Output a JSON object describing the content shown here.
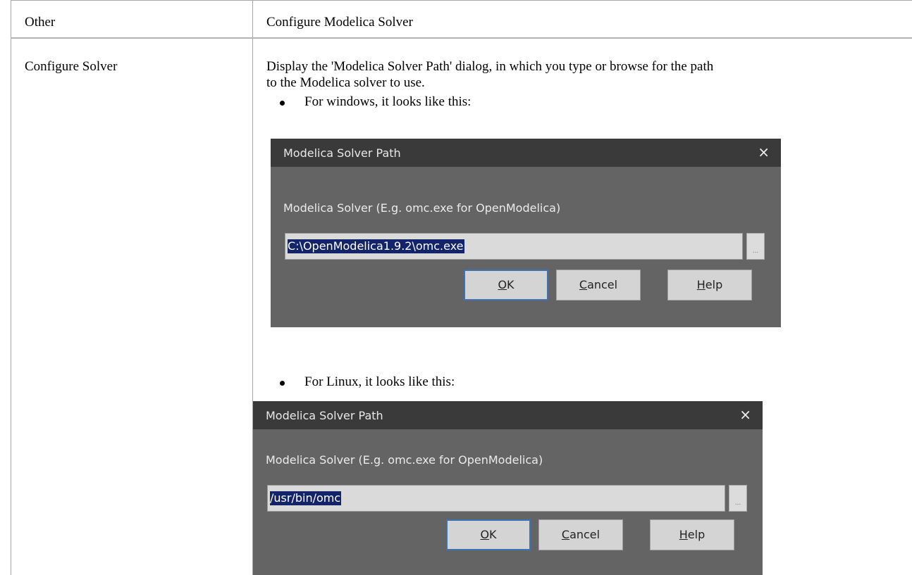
{
  "table": {
    "header": {
      "left": "Other",
      "right": "Configure Modelica Solver"
    },
    "row": {
      "left": "Configure Solver",
      "description_line1": "Display the 'Modelica Solver Path' dialog, in which you type or browse for the path",
      "description_line2": "to the Modelica solver to use.",
      "bullet_windows": "For windows, it looks like this:",
      "bullet_linux": "For Linux, it looks like this:"
    }
  },
  "dialog_windows": {
    "title": "Modelica Solver Path",
    "close_glyph": "×",
    "label": "Modelica Solver (E.g. omc.exe for OpenModelica)",
    "path_value": "C:\\OpenModelica1.9.2\\omc.exe",
    "browse_label": "...",
    "ok_key": "O",
    "ok_rest": "K",
    "cancel_key": "C",
    "cancel_rest": "ancel",
    "help_key": "H",
    "help_rest": "elp"
  },
  "dialog_linux": {
    "title": "Modelica Solver Path",
    "close_glyph": "×",
    "label": "Modelica Solver (E.g. omc.exe for OpenModelica)",
    "path_value": "/usr/bin/omc",
    "browse_label": "...",
    "ok_key": "O",
    "ok_rest": "K",
    "cancel_key": "C",
    "cancel_rest": "ancel",
    "help_key": "H",
    "help_rest": "elp"
  },
  "colors": {
    "dialog_bg": "#646464",
    "titlebar_bg": "#3a3a3a",
    "selection_bg": "#13246b",
    "default_button_border": "#3d72b4"
  }
}
